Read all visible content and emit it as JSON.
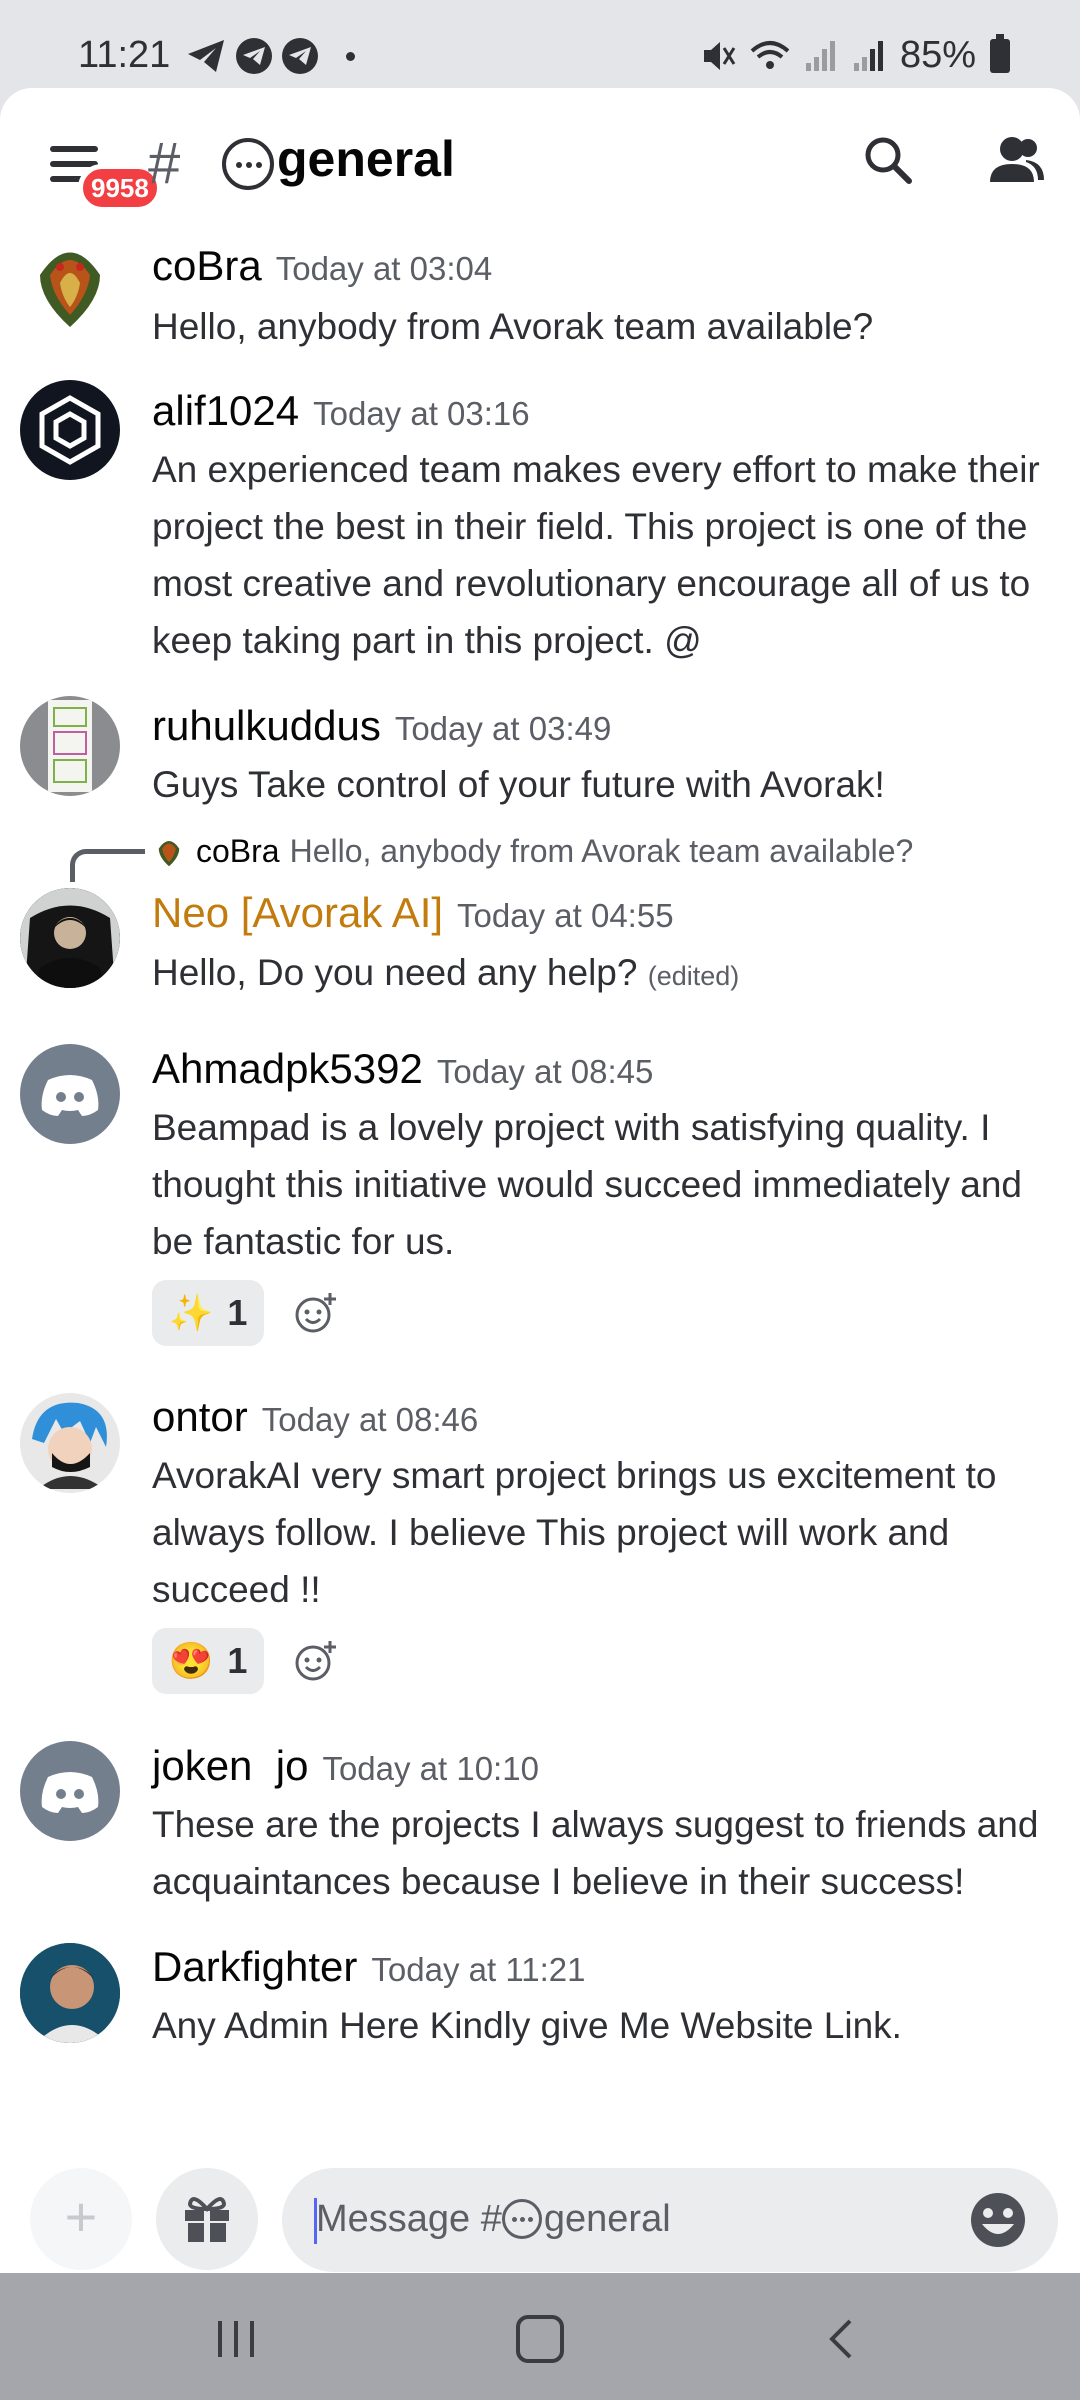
{
  "status_bar": {
    "time": "11:21",
    "battery": "85%"
  },
  "header": {
    "notification_badge": "9958",
    "channel_hash": "#",
    "channel_name": "general"
  },
  "messages": [
    {
      "author": "coBra",
      "timestamp": "Today at 03:04",
      "text": "Hello, anybody from Avorak team available?"
    },
    {
      "author": "alif1024",
      "timestamp": "Today at 03:16",
      "text": "An experienced team makes every effort to make their project the best in their field. This project is one of the most creative and revolutionary encourage all of us to keep taking part in this project. @"
    },
    {
      "author": "ruhulkuddus",
      "timestamp": "Today at 03:49",
      "text": "Guys Take control of your future with Avorak!"
    },
    {
      "author": "Neo [Avorak AI]",
      "timestamp": "Today at 04:55",
      "text": "Hello, Do you need any help?",
      "edited": "(edited)",
      "reply_author": "coBra",
      "reply_text": "Hello, anybody from Avorak team available?",
      "author_color": "#c27c0e"
    },
    {
      "author": "Ahmadpk5392",
      "timestamp": "Today at 08:45",
      "text": "Beampad is a lovely project with satisfying quality. I thought this initiative would succeed immediately and be fantastic for us.",
      "reaction_emoji": "✨",
      "reaction_count": "1"
    },
    {
      "author": "ontor",
      "timestamp": "Today at 08:46",
      "text": "AvorakAI very smart project brings us excitement to always follow. I believe This project will work and succeed !!",
      "reaction_emoji": "😍",
      "reaction_count": "1"
    },
    {
      "author": "joken  jo",
      "timestamp": "Today at 10:10",
      "text": "These are the projects I always suggest to friends and acquaintances because I believe in their success!"
    },
    {
      "author": "Darkfighter",
      "timestamp": "Today at 11:21",
      "text": "Any Admin Here Kindly give Me Website Link."
    }
  ],
  "composer": {
    "placeholder_prefix": "Message #",
    "placeholder_channel": "general"
  },
  "colors": {
    "accent": "#5865f2",
    "badge": "#f23f43",
    "role_color": "#c27c0e",
    "discord_grey": "#747f8d"
  }
}
